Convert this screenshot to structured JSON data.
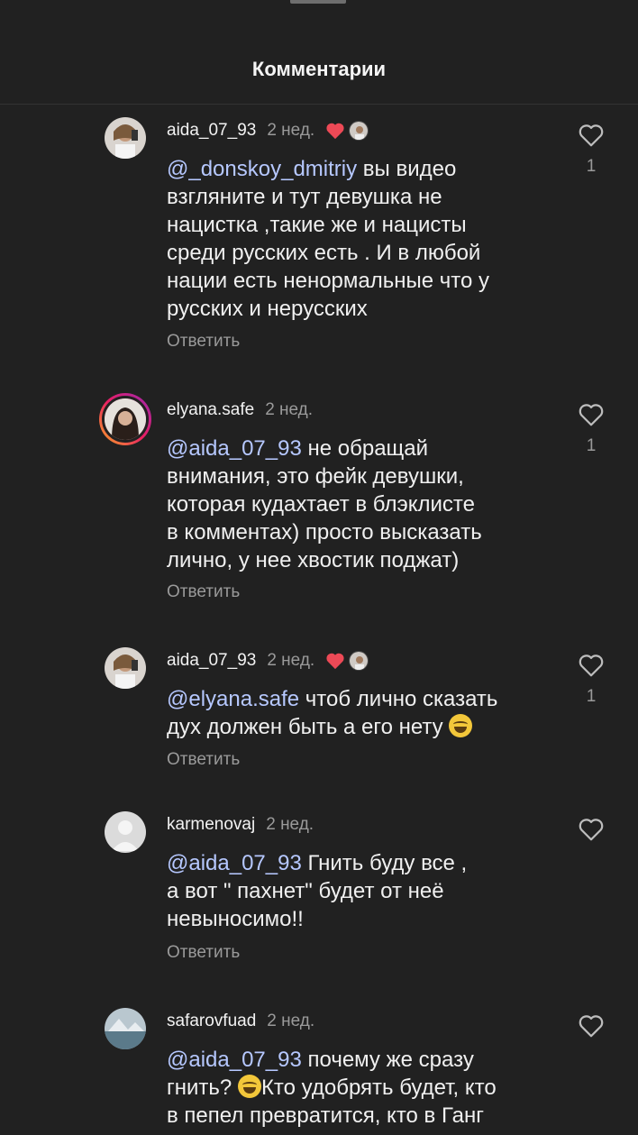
{
  "header": {
    "title": "Комментарии"
  },
  "comments": [
    {
      "username": "aida_07_93",
      "time": "2 нед.",
      "liked_by_author": true,
      "mention": "@_donskoy_dmitriy",
      "text": " вы видео\nвзгляните и тут девушка не\nнацистка ,такие же и нацисты\nсреди русских есть . И в любой\nнации есть ненормальные  что у\nрусских и нерусских",
      "reply": "Ответить",
      "likes": "1"
    },
    {
      "username": "elyana.safe",
      "time": "2 нед.",
      "liked_by_author": false,
      "mention": "@aida_07_93",
      "text": " не обращай\nвнимания, это фейк девушки,\nкоторая кудахтает в блэклисте\nв комментах) просто высказать\nлично, у нее хвостик поджат)",
      "reply": "Ответить",
      "likes": "1"
    },
    {
      "username": "aida_07_93",
      "time": "2 нед.",
      "liked_by_author": true,
      "mention": "@elyana.safe",
      "text": " чтоб лично сказать\nдух должен быть а его нету",
      "emoji": "grinning-squinting-face",
      "reply": "Ответить",
      "likes": "1"
    },
    {
      "username": "karmenovaj",
      "time": "2 нед.",
      "liked_by_author": false,
      "mention": "@aida_07_93",
      "text": " Гнить буду все ,\nа вот \" пахнет\" будет от неё\nневыносимо!!",
      "reply": "Ответить",
      "likes": ""
    },
    {
      "username": "safarovfuad",
      "time": "2 нед.",
      "liked_by_author": false,
      "mention": "@aida_07_93",
      "text_a": " почему же сразу\nгнить? ",
      "emoji": "grinning-squinting-face",
      "text_b": "Кто удобрять будет, кто\nв пепел превратится, кто в Ганг",
      "reply": "",
      "likes": ""
    }
  ],
  "colors": {
    "background": "#212121",
    "mention": "#b6c8ff",
    "heart": "#ed4956",
    "muted": "#9a9a9a"
  }
}
